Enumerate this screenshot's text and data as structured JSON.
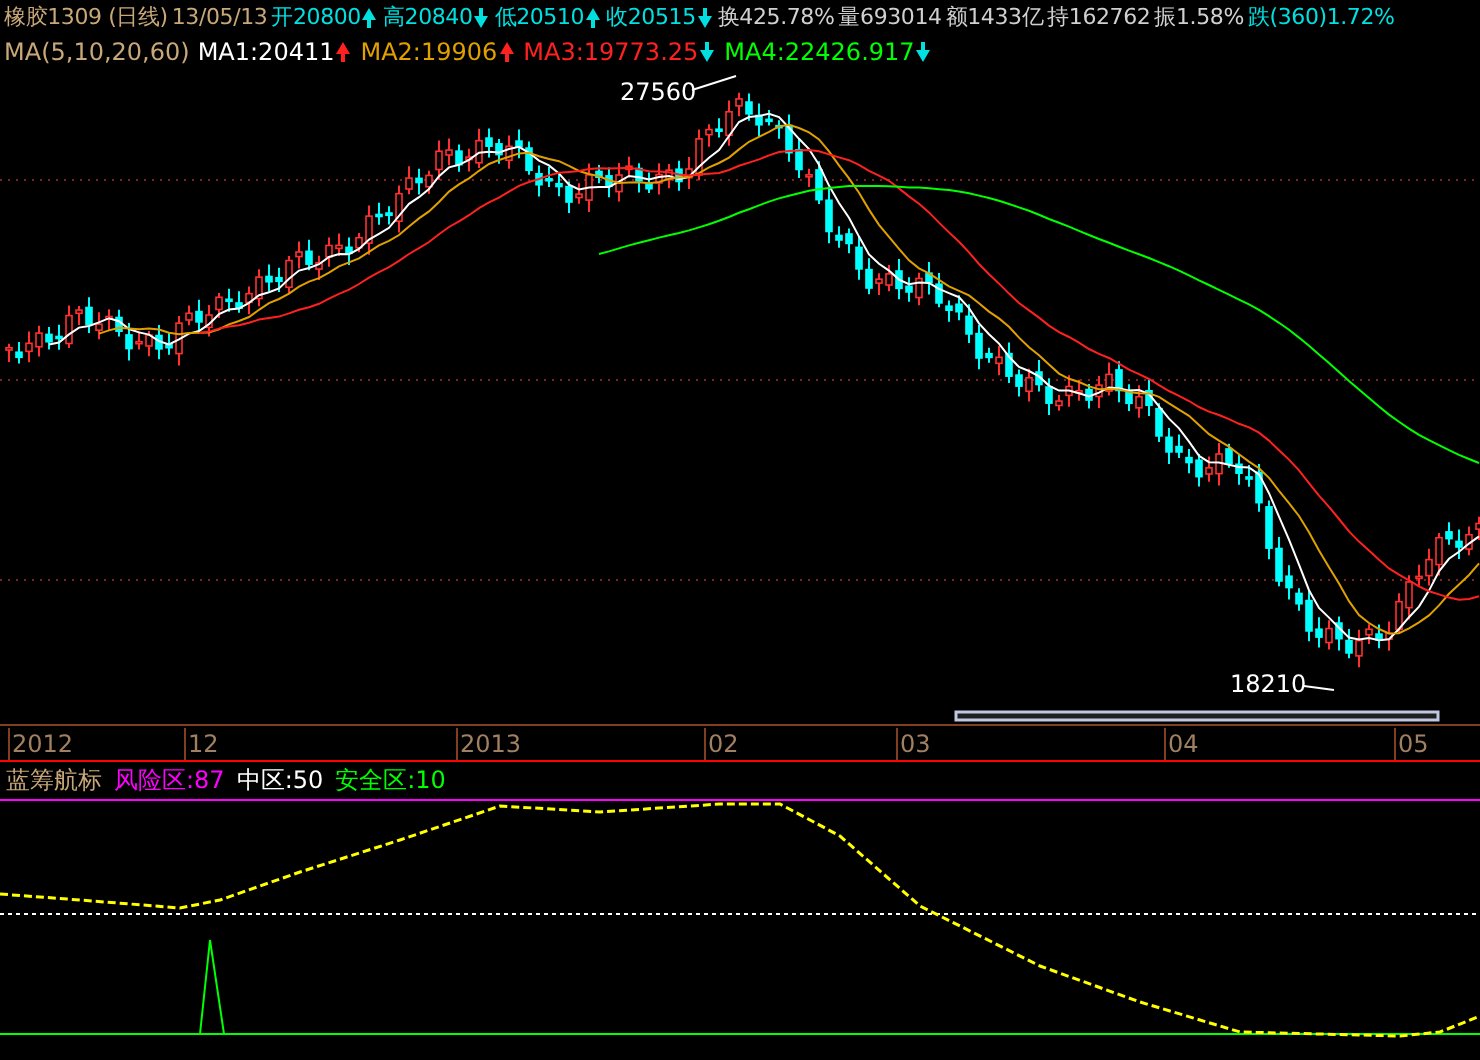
{
  "header": {
    "title": "橡胶1309 (日线)",
    "date": "13/05/13",
    "prices": [
      {
        "label": "开20800",
        "rising": true
      },
      {
        "label": "高20840",
        "rising": false
      },
      {
        "label": "低20510",
        "rising": true
      },
      {
        "label": "收20515",
        "rising": false
      }
    ],
    "stats": [
      "换425.78%",
      "量693014",
      "额1433亿",
      "持162762",
      "振1.58%"
    ],
    "change": "跌(360)1.72%"
  },
  "ma": {
    "label": "MA(5,10,20,60)",
    "lines": [
      {
        "label": "MA1:20411",
        "rising": true,
        "color": "#ffffff"
      },
      {
        "label": "MA2:19906",
        "rising": true,
        "color": "#e0a000"
      },
      {
        "label": "MA3:19773.25",
        "rising": false,
        "color": "#ff2020"
      },
      {
        "label": "MA4:22426.917",
        "rising": false,
        "color": "#00ff00"
      }
    ]
  },
  "chart": {
    "high_label": "27560",
    "low_label": "18210"
  },
  "axis": {
    "labels": [
      "2012",
      "12",
      "2013",
      "02",
      "03",
      "04",
      "05"
    ]
  },
  "indicator": {
    "name": "蓝筹航标",
    "zones": [
      {
        "label": "风险区:87",
        "color": "#ff00ff"
      },
      {
        "label": "中区:50",
        "color": "#ffffff"
      },
      {
        "label": "安全区:10",
        "color": "#00ff00"
      }
    ]
  }
}
